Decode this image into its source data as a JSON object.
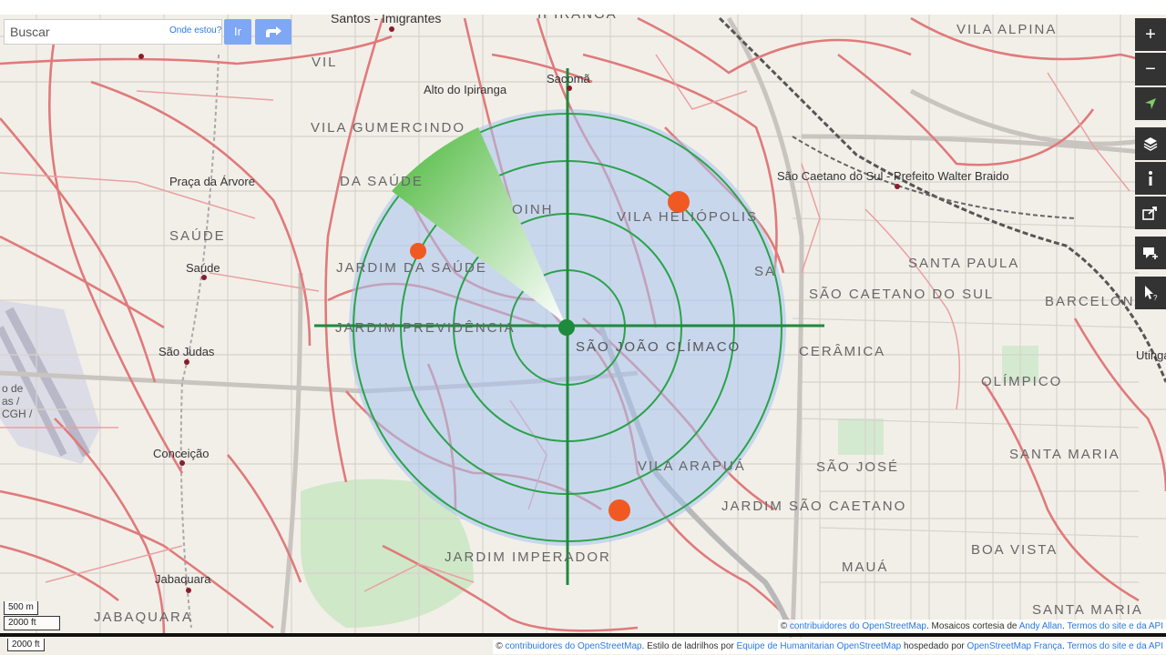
{
  "search": {
    "placeholder": "Buscar",
    "where_link": "Onde estou?",
    "go_label": "Ir"
  },
  "controls": {
    "zoom_in": "+",
    "zoom_out": "−"
  },
  "scale": {
    "metric": "500 m",
    "imperial": "2000 ft",
    "lower_imperial": "2000 ft"
  },
  "attribution": {
    "line1_prefix": "© ",
    "line1_link": "contribuidores do OpenStreetMap",
    "line1_mid": ". Mosaicos cortesia de ",
    "line1_author": "Andy Allan",
    "line1_sep": ". ",
    "line1_terms": "Termos do site e da API",
    "line2_prefix": "© ",
    "line2_link": "contribuidores do OpenStreetMap",
    "line2_mid": ". Estilo de ladrilhos por ",
    "line2_team": "Equipe de Humanitarian OpenStreetMap",
    "line2_hosted": " hospedado por ",
    "line2_host": "OpenStreetMap França",
    "line2_sep": ". ",
    "line2_terms": "Termos do site e da API"
  },
  "map": {
    "places": [
      {
        "name": "Santos - Imigrantes"
      },
      {
        "name": "IPIRANGA"
      },
      {
        "name": "VILA ALPINA"
      },
      {
        "name": "VIL"
      },
      {
        "name": "Sacomã"
      },
      {
        "name": "Alto do Ipiranga"
      },
      {
        "name": "VILA GUMERCINDO"
      },
      {
        "name": "DA SAÚDE"
      },
      {
        "name": "Praça da Árvore"
      },
      {
        "name": "São Caetano do Sul - Prefeito Walter Braido"
      },
      {
        "name": "VILA HELIÓPOLIS"
      },
      {
        "name": "SAÚDE"
      },
      {
        "name": "Saúde"
      },
      {
        "name": "JARDIM DA SAÚDE"
      },
      {
        "name": "SANTA PAULA"
      },
      {
        "name": "SA"
      },
      {
        "name": "SÃO CAETANO DO SUL"
      },
      {
        "name": "BARCELONA"
      },
      {
        "name": "JARDIM PREVIDÊNCIA"
      },
      {
        "name": "SÃO JOÃO CLÍMACO"
      },
      {
        "name": "São Judas"
      },
      {
        "name": "CERÂMICA"
      },
      {
        "name": "Utinga"
      },
      {
        "name": "OLÍMPICO"
      },
      {
        "name": "Conceição"
      },
      {
        "name": "SANTA MARIA"
      },
      {
        "name": "VILA ARAPUÁ"
      },
      {
        "name": "SÃO JOSÉ"
      },
      {
        "name": "JARDIM SÃO CAETANO"
      },
      {
        "name": "JARDIM IMPERADOR"
      },
      {
        "name": "BOA VISTA"
      },
      {
        "name": "MAUÁ"
      },
      {
        "name": "Jabaquara"
      },
      {
        "name": "JABAQUARA"
      },
      {
        "name": "SANTA MARIA"
      },
      {
        "name": "OINH"
      },
      {
        "name": "o de"
      },
      {
        "name": "as /"
      },
      {
        "name": "CGH /"
      }
    ]
  },
  "colors": {
    "road_red": "#e07a7a",
    "radar_fill": "#a8c2f0",
    "radar_ring": "#2aa34a",
    "marker": "#f05a22",
    "button_blue": "#7ea7f5",
    "control_bg": "#333333"
  },
  "icons": {
    "directions": "directions-icon",
    "location": "locate-icon",
    "layers": "layers-icon",
    "info": "info-icon",
    "share": "share-icon",
    "note": "note-icon",
    "query": "query-icon"
  }
}
